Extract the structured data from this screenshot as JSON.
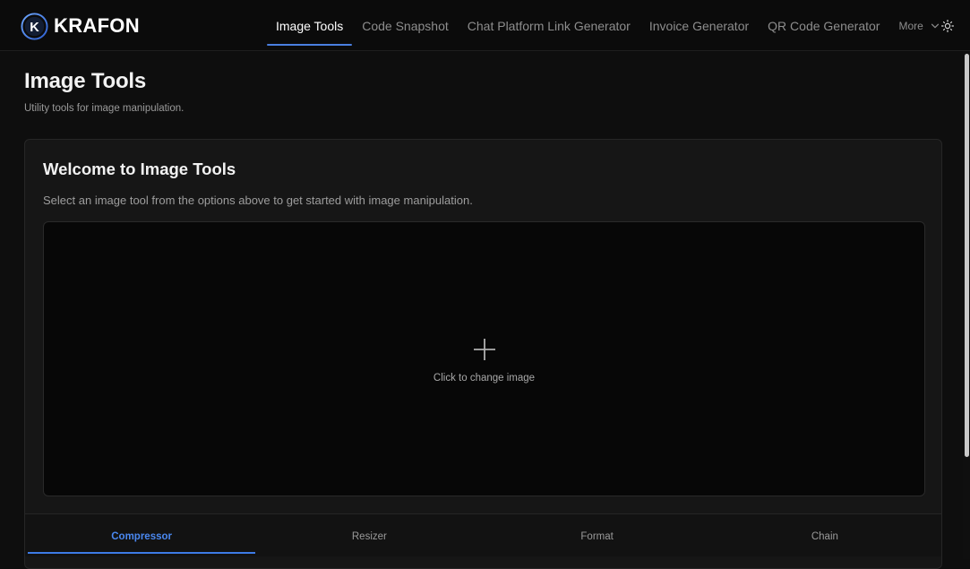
{
  "brand": {
    "name": "KRAFON",
    "mark_letter": "K"
  },
  "nav": {
    "items": [
      {
        "label": "Image Tools"
      },
      {
        "label": "Code Snapshot"
      },
      {
        "label": "Chat Platform Link Generator"
      },
      {
        "label": "Invoice Generator"
      },
      {
        "label": "QR Code Generator"
      }
    ],
    "active_index": 0,
    "more_label": "More"
  },
  "page": {
    "title": "Image Tools",
    "subtitle": "Utility tools for image manipulation."
  },
  "card": {
    "title": "Welcome to Image Tools",
    "description": "Select an image tool from the options above to get started with image manipulation.",
    "dropzone_label": "Click to change image"
  },
  "tabs": {
    "items": [
      {
        "label": "Compressor"
      },
      {
        "label": "Resizer"
      },
      {
        "label": "Format"
      },
      {
        "label": "Chain"
      }
    ],
    "active_index": 0
  },
  "colors": {
    "accent": "#4a88f0",
    "background": "#0e0e0e",
    "card": "#161616"
  },
  "icons": [
    "logo-k-icon",
    "chevron-down-icon",
    "sun-icon",
    "plus-icon"
  ]
}
